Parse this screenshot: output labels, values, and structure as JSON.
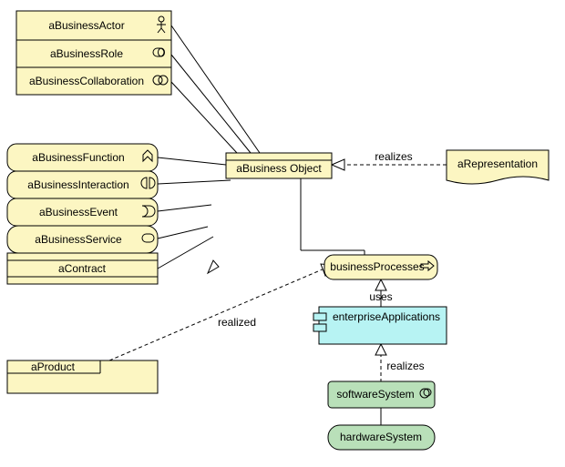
{
  "elements": {
    "actor": "aBusinessActor",
    "role": "aBusinessRole",
    "collab": "aBusinessCollaboration",
    "func": "aBusinessFunction",
    "inter": "aBusinessInteraction",
    "event": "aBusinessEvent",
    "service": "aBusinessService",
    "contract": "aContract",
    "product": "aProduct",
    "object": "aBusiness Object",
    "repr": "aRepresentation",
    "proc": "businessProcesses",
    "app": "enterpriseApplications",
    "soft": "softwareSystem",
    "hard": "hardwareSystem"
  },
  "labels": {
    "realizes1": "realizes",
    "uses": "uses",
    "realizes2": "realizes",
    "realized": "realized"
  },
  "chart_data": {
    "type": "diagram",
    "notation": "ArchiMate",
    "nodes": [
      {
        "id": "actor",
        "name": "aBusinessActor",
        "type": "BusinessActor",
        "layer": "business"
      },
      {
        "id": "role",
        "name": "aBusinessRole",
        "type": "BusinessRole",
        "layer": "business"
      },
      {
        "id": "collab",
        "name": "aBusinessCollaboration",
        "type": "BusinessCollaboration",
        "layer": "business"
      },
      {
        "id": "func",
        "name": "aBusinessFunction",
        "type": "BusinessFunction",
        "layer": "business"
      },
      {
        "id": "inter",
        "name": "aBusinessInteraction",
        "type": "BusinessInteraction",
        "layer": "business"
      },
      {
        "id": "event",
        "name": "aBusinessEvent",
        "type": "BusinessEvent",
        "layer": "business"
      },
      {
        "id": "service",
        "name": "aBusinessService",
        "type": "BusinessService",
        "layer": "business"
      },
      {
        "id": "contract",
        "name": "aContract",
        "type": "Contract",
        "layer": "business"
      },
      {
        "id": "product",
        "name": "aProduct",
        "type": "Product",
        "layer": "business"
      },
      {
        "id": "object",
        "name": "aBusiness Object",
        "type": "BusinessObject",
        "layer": "business"
      },
      {
        "id": "repr",
        "name": "aRepresentation",
        "type": "Representation",
        "layer": "business"
      },
      {
        "id": "proc",
        "name": "businessProcesses",
        "type": "BusinessProcess",
        "layer": "business"
      },
      {
        "id": "app",
        "name": "enterpriseApplications",
        "type": "ApplicationComponent",
        "layer": "application"
      },
      {
        "id": "soft",
        "name": "softwareSystem",
        "type": "SystemSoftware",
        "layer": "technology"
      },
      {
        "id": "hard",
        "name": "hardwareSystem",
        "type": "Device",
        "layer": "technology"
      }
    ],
    "edges": [
      {
        "from": "actor",
        "to": "object",
        "type": "access"
      },
      {
        "from": "role",
        "to": "object",
        "type": "access"
      },
      {
        "from": "collab",
        "to": "object",
        "type": "access"
      },
      {
        "from": "func",
        "to": "object",
        "type": "access"
      },
      {
        "from": "inter",
        "to": "object",
        "type": "access"
      },
      {
        "from": "event",
        "to": "object",
        "type": "access"
      },
      {
        "from": "service",
        "to": "object",
        "type": "access"
      },
      {
        "from": "contract",
        "to": "object",
        "type": "access"
      },
      {
        "from": "repr",
        "to": "object",
        "type": "realization",
        "label": "realizes"
      },
      {
        "from": "proc",
        "to": "object",
        "type": "association"
      },
      {
        "from": "product",
        "to": "proc",
        "type": "realization",
        "label": "realized"
      },
      {
        "from": "app",
        "to": "proc",
        "type": "usedBy",
        "label": "uses"
      },
      {
        "from": "soft",
        "to": "app",
        "type": "realization",
        "label": "realizes"
      },
      {
        "from": "hard",
        "to": "soft",
        "type": "association"
      }
    ],
    "colors": {
      "business": "#fcf6c2",
      "application": "#b7f3f3",
      "technology": "#b9e0b9"
    }
  }
}
